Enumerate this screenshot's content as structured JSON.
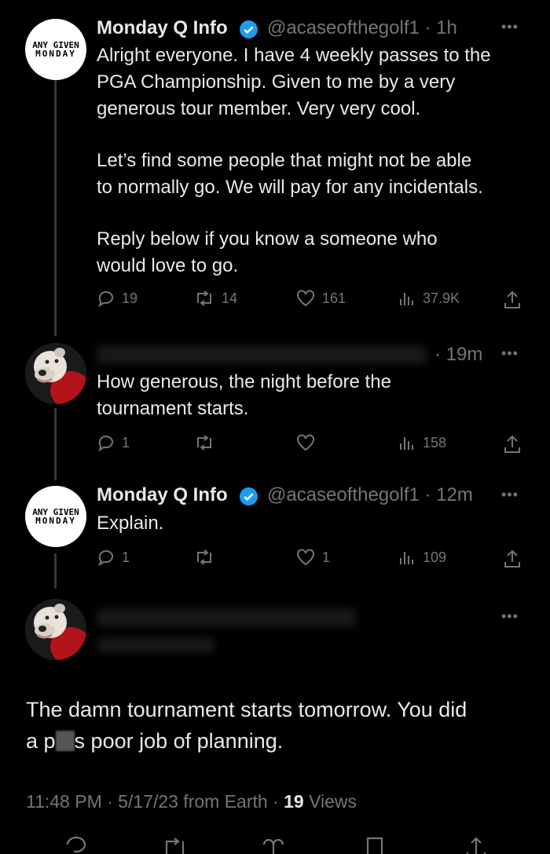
{
  "tweet1": {
    "name": "Monday Q Info",
    "handle_time": "@acaseofthegolf1 · 1h",
    "logo_line1": "ANY GIVEN",
    "logo_line2": "MONDAY",
    "paragraphs": [
      "Alright everyone. I have 4 weekly passes to the\nPGA Championship. Given to me by a very\ngenerous tour member. Very very cool.",
      "Let’s find some people that might not be able\nto normally go. We will pay for any incidentals.",
      "Reply below if you know a someone who\nwould love to go."
    ],
    "replies": "19",
    "retweets": "14",
    "likes": "161",
    "views": "37.9K"
  },
  "reply1": {
    "time": "· 19m",
    "text": "How generous, the night before the\ntournament starts.",
    "replies": "1",
    "views": "158"
  },
  "tweet2": {
    "name": "Monday Q Info",
    "handle_time": "@acaseofthegolf1 · 12m",
    "text": "Explain.",
    "replies": "1",
    "likes": "1",
    "views": "109"
  },
  "main": {
    "text_before": "The damn tournament starts tomorrow.  You did",
    "text_line2_a": "a p",
    "text_line2_b": "s poor job of planning.",
    "time": "11:48 PM · 5/17/23 from Earth · ",
    "views_count": "19",
    "views_label": " Views"
  },
  "colors": {
    "background": "#000000",
    "text": "#e7e9ea",
    "muted": "#71767b",
    "verified": "#1d9bf0"
  }
}
